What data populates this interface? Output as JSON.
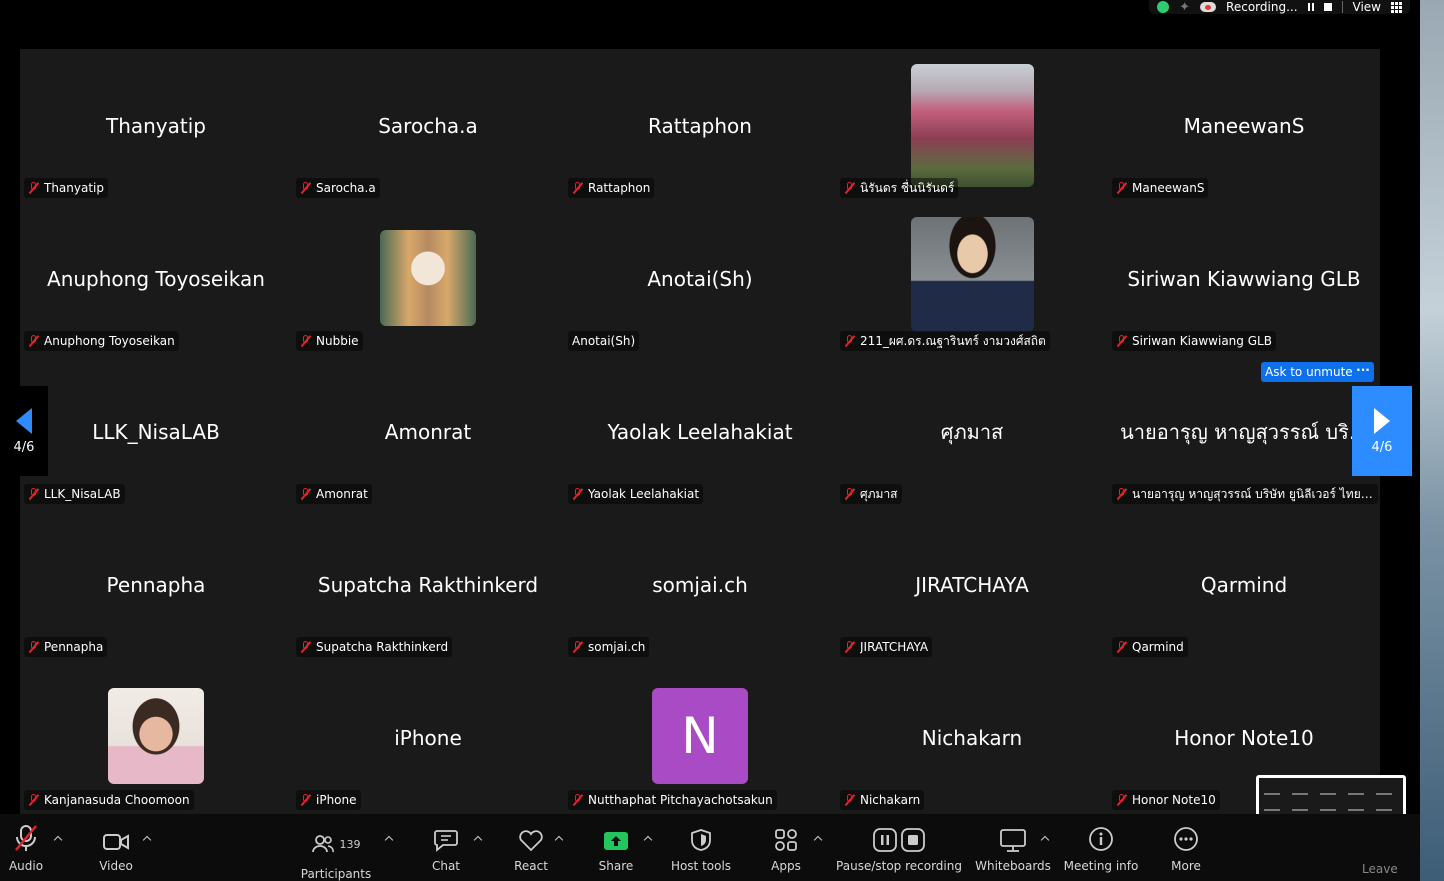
{
  "status_bar": {
    "recording_text": "Recording...",
    "view_label": "View"
  },
  "pagination": {
    "prev_page": "4/6",
    "next_page": "4/6"
  },
  "tile_controls": {
    "ask_to_unmute": "Ask to unmute",
    "more": "···"
  },
  "participants": [
    {
      "display": "Thanyatip",
      "tag": "Thanyatip",
      "muted": true
    },
    {
      "display": "Sarocha.a",
      "tag": "Sarocha.a",
      "muted": true
    },
    {
      "display": "Rattaphon",
      "tag": "Rattaphon",
      "muted": true
    },
    {
      "display": "",
      "tag": "นิรันดร ชื่นนิรันดร์",
      "muted": true,
      "avatar": "lotus-photo"
    },
    {
      "display": "ManeewanS",
      "tag": "ManeewanS",
      "muted": true
    },
    {
      "display": "Anuphong Toyoseikan",
      "tag": "Anuphong Toyoseikan",
      "muted": true
    },
    {
      "display": "",
      "tag": "Nubbie",
      "muted": true,
      "avatar": "woman-car-photo"
    },
    {
      "display": "Anotai(Sh)",
      "tag": "Anotai(Sh)",
      "muted": false
    },
    {
      "display": "",
      "tag": "211_ผศ.ดร.ณฐารินทร์ งามวงศ์สถิต",
      "muted": true,
      "avatar": "portrait-photo"
    },
    {
      "display": "Siriwan Kiawwiang GLB",
      "tag": "Siriwan Kiawwiang GLB",
      "muted": true
    },
    {
      "display": "LLK_NisaLAB",
      "tag": "LLK_NisaLAB",
      "muted": true
    },
    {
      "display": "Amonrat",
      "tag": "Amonrat",
      "muted": true
    },
    {
      "display": "Yaolak Leelahakiat",
      "tag": "Yaolak Leelahakiat",
      "muted": true
    },
    {
      "display": "ศุภมาส",
      "tag": "ศุภมาส",
      "muted": true
    },
    {
      "display": "นายอารุญ หาญสุวรรณ์ บริ...",
      "tag": "นายอารุญ หาญสุวรรณ์ บริษัท ยูนิลีเวอร์ ไทยโฮ...",
      "muted": true
    },
    {
      "display": "Pennapha",
      "tag": "Pennapha",
      "muted": true
    },
    {
      "display": "Supatcha Rakthinkerd",
      "tag": "Supatcha Rakthinkerd",
      "muted": true
    },
    {
      "display": "somjai.ch",
      "tag": "somjai.ch",
      "muted": true
    },
    {
      "display": "JIRATCHAYA",
      "tag": "JIRATCHAYA",
      "muted": true
    },
    {
      "display": "Qarmind",
      "tag": "Qarmind",
      "muted": true
    },
    {
      "display": "",
      "tag": "Kanjanasuda Choomoon",
      "muted": true,
      "avatar": "smiling-woman-photo"
    },
    {
      "display": "iPhone",
      "tag": "iPhone",
      "muted": true
    },
    {
      "display": "",
      "tag": "Nutthaphat Pitchayachotsakun",
      "muted": true,
      "avatar": "initial",
      "initial": "N",
      "avatar_color": "#a84bc4"
    },
    {
      "display": "Nichakarn",
      "tag": "Nichakarn",
      "muted": true
    },
    {
      "display": "Honor Note10",
      "tag": "Honor Note10",
      "muted": true
    }
  ],
  "toolbar": {
    "audio": "Audio",
    "video": "Video",
    "participants": "Participants",
    "participants_count": "139",
    "chat": "Chat",
    "react": "React",
    "share": "Share",
    "host_tools": "Host tools",
    "apps": "Apps",
    "pause_stop_recording": "Pause/stop recording",
    "whiteboards": "Whiteboards",
    "meeting_info": "Meeting info",
    "more": "More",
    "leave": "Leave"
  },
  "colors": {
    "accent_blue": "#2d8cff",
    "unmute_blue": "#0e71eb",
    "mute_red": "#e0242e",
    "share_green": "#22c55e",
    "tile_bg": "#1a1a1a"
  }
}
